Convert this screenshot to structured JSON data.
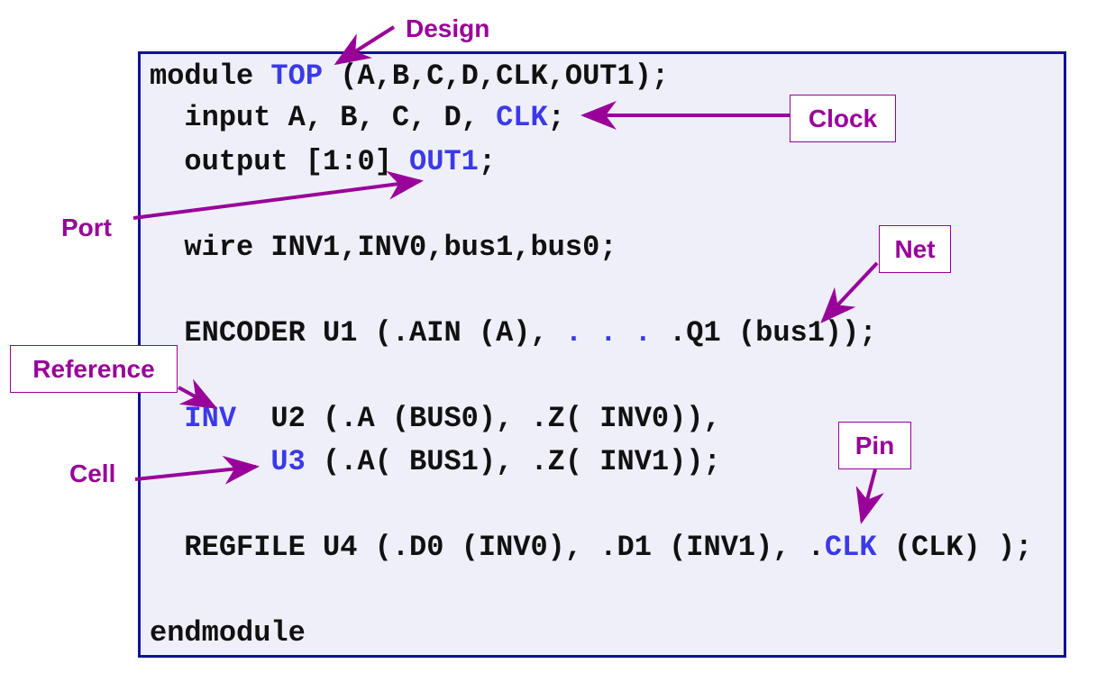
{
  "colors": {
    "label": "#990099",
    "highlight": "#3a3ae8",
    "border": "#10109a",
    "background": "#efeffa"
  },
  "code": [
    [
      {
        "t": "module "
      },
      {
        "t": "TOP",
        "h": true
      },
      {
        "t": " (A,B,C,D,CLK,OUT1);"
      }
    ],
    [
      {
        "t": "  input A, B, C, D, "
      },
      {
        "t": "CLK",
        "h": true
      },
      {
        "t": ";"
      }
    ],
    [
      {
        "t": "  output [1:0] "
      },
      {
        "t": "OUT1",
        "h": true
      },
      {
        "t": ";"
      }
    ],
    [
      {
        "t": "  wire INV1,INV0,bus1,bus0;"
      }
    ],
    [
      {
        "t": "  ENCODER U1 (.AIN (A), "
      },
      {
        "t": ". . .",
        "h": true
      },
      {
        "t": " .Q1 (bus1));"
      }
    ],
    [
      {
        "t": "  "
      },
      {
        "t": "INV",
        "h": true
      },
      {
        "t": "  U2 (.A (BUS0), .Z( INV0)),"
      }
    ],
    [
      {
        "t": "       "
      },
      {
        "t": "U3",
        "h": true
      },
      {
        "t": " (.A( BUS1), .Z( INV1));"
      }
    ],
    [
      {
        "t": "  REGFILE U4 (.D0 (INV0), .D1 (INV1), ."
      },
      {
        "t": "CLK",
        "h": true
      },
      {
        "t": " (CLK) );"
      }
    ],
    [
      {
        "t": "endmodule"
      }
    ]
  ],
  "labels": {
    "design": "Design",
    "clock": "Clock",
    "port": "Port",
    "net": "Net",
    "reference": "Reference",
    "cell": "Cell",
    "pin": "Pin"
  }
}
